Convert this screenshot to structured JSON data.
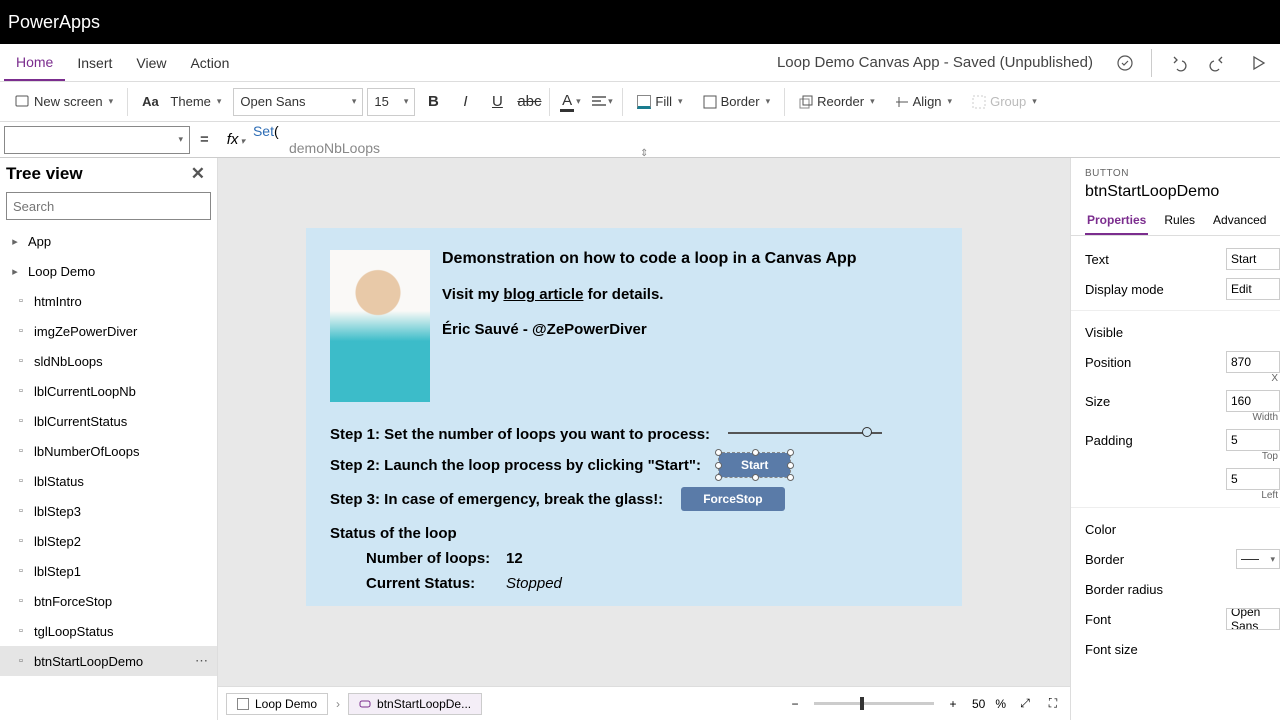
{
  "titlebar": {
    "app": "PowerApps"
  },
  "menubar": {
    "tabs": [
      "Home",
      "Insert",
      "View",
      "Action"
    ],
    "save_status": "Loop Demo Canvas App - Saved (Unpublished)"
  },
  "toolbar": {
    "newscreen": "New screen",
    "theme": "Theme",
    "font": "Open Sans",
    "size": "15",
    "fill": "Fill",
    "border": "Border",
    "reorder": "Reorder",
    "align": "Align",
    "group": "Group"
  },
  "formula": {
    "eq": "=",
    "fx": "fx",
    "fn": "Set",
    "open": "(",
    "line2": "demoNbLoops"
  },
  "left": {
    "title": "Tree view",
    "search_placeholder": "Search",
    "items": [
      {
        "label": "App",
        "indent": 0
      },
      {
        "label": "Loop Demo",
        "indent": 0
      },
      {
        "label": "htmIntro",
        "indent": 1
      },
      {
        "label": "imgZePowerDiver",
        "indent": 1
      },
      {
        "label": "sldNbLoops",
        "indent": 1
      },
      {
        "label": "lblCurrentLoopNb",
        "indent": 1
      },
      {
        "label": "lblCurrentStatus",
        "indent": 1
      },
      {
        "label": "lbNumberOfLoops",
        "indent": 1
      },
      {
        "label": "lblStatus",
        "indent": 1
      },
      {
        "label": "lblStep3",
        "indent": 1
      },
      {
        "label": "lblStep2",
        "indent": 1
      },
      {
        "label": "lblStep1",
        "indent": 1
      },
      {
        "label": "btnForceStop",
        "indent": 1
      },
      {
        "label": "tglLoopStatus",
        "indent": 1
      },
      {
        "label": "btnStartLoopDemo",
        "indent": 1,
        "selected": true
      }
    ]
  },
  "canvas": {
    "title": "Demonstration on how to code a loop in a Canvas App",
    "visit_pre": "Visit my ",
    "visit_link": "blog article",
    "visit_post": " for details.",
    "author": "Éric Sauvé - @ZePowerDiver",
    "step1": "Step 1: Set the number of loops you want to process:",
    "step2": "Step 2: Launch the loop process by clicking \"Start\":",
    "step3": "Step 3: In case of emergency, break the glass!:",
    "start": "Start",
    "forcestop": "ForceStop",
    "status_hdr": "Status of the loop",
    "nloops_lbl": "Number of loops:",
    "nloops_val": "12",
    "curstat_lbl": "Current Status:",
    "curstat_val": "Stopped"
  },
  "footer": {
    "crumb1": "Loop Demo",
    "crumb2": "btnStartLoopDe...",
    "zoom": "50",
    "pct": "%"
  },
  "right": {
    "category": "BUTTON",
    "name": "btnStartLoopDemo",
    "tabs": [
      "Properties",
      "Rules",
      "Advanced"
    ],
    "props": {
      "text_l": "Text",
      "text_v": "Start",
      "disp_l": "Display mode",
      "disp_v": "Edit",
      "vis_l": "Visible",
      "pos_l": "Position",
      "pos_v": "870",
      "pos_sub": "X",
      "size_l": "Size",
      "size_v": "160",
      "size_sub": "Width",
      "pad_l": "Padding",
      "pad_v1": "5",
      "pad_sub1": "Top",
      "pad_v2": "5",
      "pad_sub2": "Left",
      "color_l": "Color",
      "border_l": "Border",
      "bradius_l": "Border radius",
      "font_l": "Font",
      "font_v": "Open Sans",
      "fsize_l": "Font size"
    }
  }
}
